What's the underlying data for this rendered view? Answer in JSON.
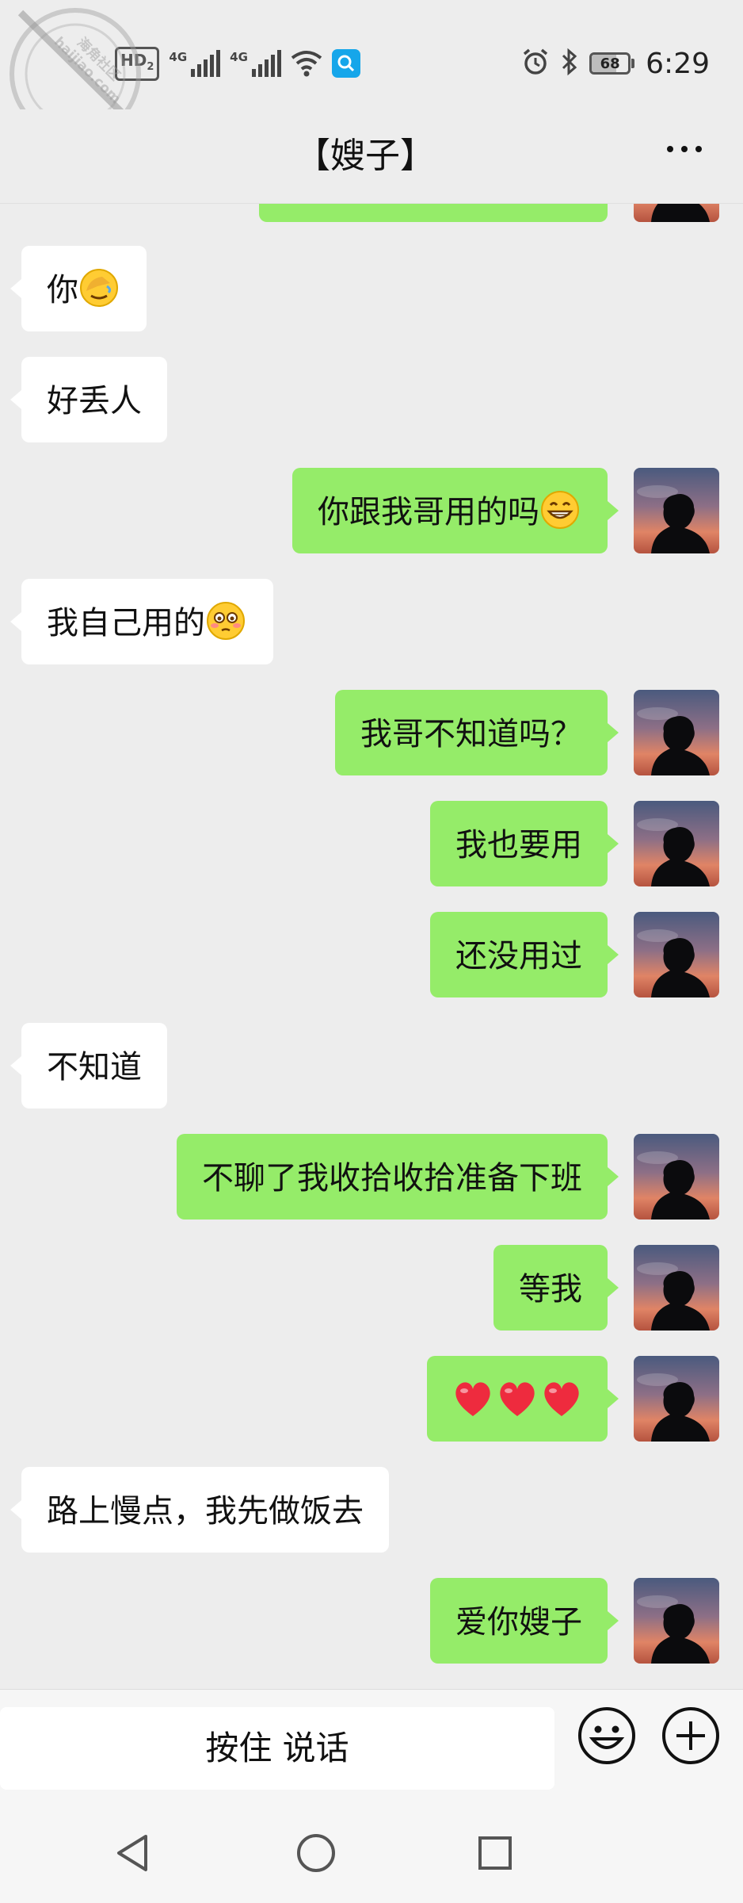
{
  "status_bar": {
    "hd_label": "HD",
    "hd_sub": "2",
    "network1": "4G",
    "network2": "4G",
    "battery_level": "68",
    "time": "6:29"
  },
  "watermark": {
    "line1": "海角社区",
    "line2": "haijiao.com"
  },
  "header": {
    "title": "【嫂子】"
  },
  "messages": [
    {
      "side": "recv",
      "text": "你",
      "emoji": "facepalm-emoji"
    },
    {
      "side": "recv",
      "text": "好丢人"
    },
    {
      "side": "sent",
      "text": "你跟我哥用的吗",
      "emoji": "grin-emoji"
    },
    {
      "side": "recv",
      "text": "我自己用的",
      "emoji": "flushed-emoji"
    },
    {
      "side": "sent",
      "text": "我哥不知道吗？"
    },
    {
      "side": "sent",
      "text": "我也要用"
    },
    {
      "side": "sent",
      "text": "还没用过"
    },
    {
      "side": "recv",
      "text": "不知道"
    },
    {
      "side": "sent",
      "text": "不聊了我收拾收拾准备下班"
    },
    {
      "side": "sent",
      "text": "等我"
    },
    {
      "side": "sent",
      "text": "",
      "emoji": "three-hearts-emoji"
    },
    {
      "side": "recv",
      "text": "路上慢点，我先做饭去"
    },
    {
      "side": "sent",
      "text": "爱你嫂子"
    }
  ],
  "input_bar": {
    "voice_label": "按住 说话"
  },
  "colors": {
    "background": "#ededed",
    "sent_bubble": "#95ec69",
    "received_bubble": "#ffffff"
  }
}
